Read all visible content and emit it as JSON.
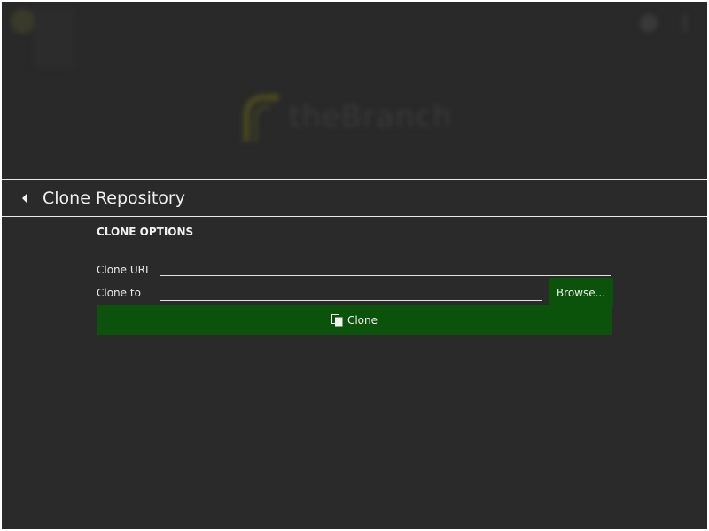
{
  "hero": {
    "brand_text": "theBranch",
    "icons": [
      "branch-logo-icon",
      "settings-icon",
      "more-icon"
    ]
  },
  "header": {
    "title": "Clone Repository",
    "back_icon": "back-arrow-icon"
  },
  "clone_options": {
    "section_title": "CLONE OPTIONS",
    "url_label": "Clone URL",
    "url_value": "",
    "to_label": "Clone to",
    "to_value": "",
    "browse_label": "Browse...",
    "clone_label": "Clone",
    "clone_icon": "copy-icon"
  },
  "colors": {
    "background": "#2a2a2a",
    "accent": "#0b520b",
    "text": "#f0f0f0",
    "divider": "#e8e8e8"
  }
}
